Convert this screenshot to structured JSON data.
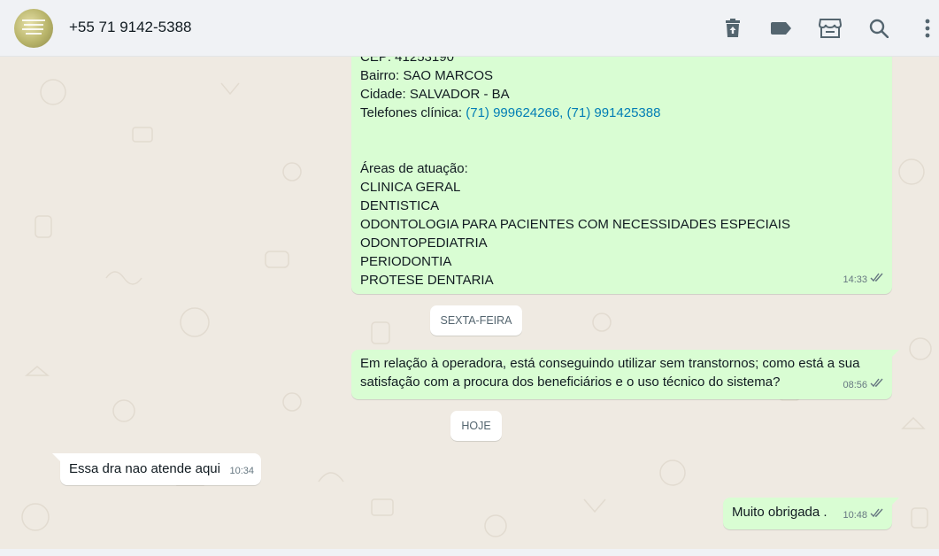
{
  "header": {
    "contact_name": "+55 71 9142-5388",
    "icons": [
      "delete-icon",
      "label-icon",
      "store-icon",
      "search-icon",
      "menu-icon"
    ]
  },
  "messages": {
    "m1": {
      "partial_top": "CEP: 41253190",
      "line_bairro": "Bairro: SAO MARCOS",
      "line_cidade": "Cidade: SALVADOR - BA",
      "phones_label": "Telefones clínica: ",
      "phone1": "(71) 999624266",
      "sep": ", ",
      "phone2": "(71) 991425388",
      "areas_title": "Áreas de atuação:",
      "areas": [
        "CLINICA GERAL",
        "DENTISTICA",
        "ODONTOLOGIA PARA PACIENTES COM NECESSIDADES ESPECIAIS",
        "ODONTOPEDIATRIA",
        "PERIODONTIA",
        "PROTESE DENTARIA"
      ],
      "time": "14:33"
    },
    "date1": "SEXTA-FEIRA",
    "m2": {
      "line1": "Em relação à operadora, está conseguindo utilizar sem transtornos; como está a sua",
      "line2": "satisfação com a procura dos beneficiários e o uso técnico do sistema?",
      "time": "08:56"
    },
    "date2": "HOJE",
    "m3": {
      "text": "Essa dra nao atende aqui",
      "time": "10:34"
    },
    "m4": {
      "text": "Muito obrigada .",
      "time": "10:48"
    }
  },
  "colors": {
    "outgoing_bubble": "#d9fdd3",
    "incoming_bubble": "#ffffff",
    "chat_background": "#efeae2",
    "link": "#027eb5",
    "header": "#f0f2f5",
    "read_ticks": "#667781"
  }
}
